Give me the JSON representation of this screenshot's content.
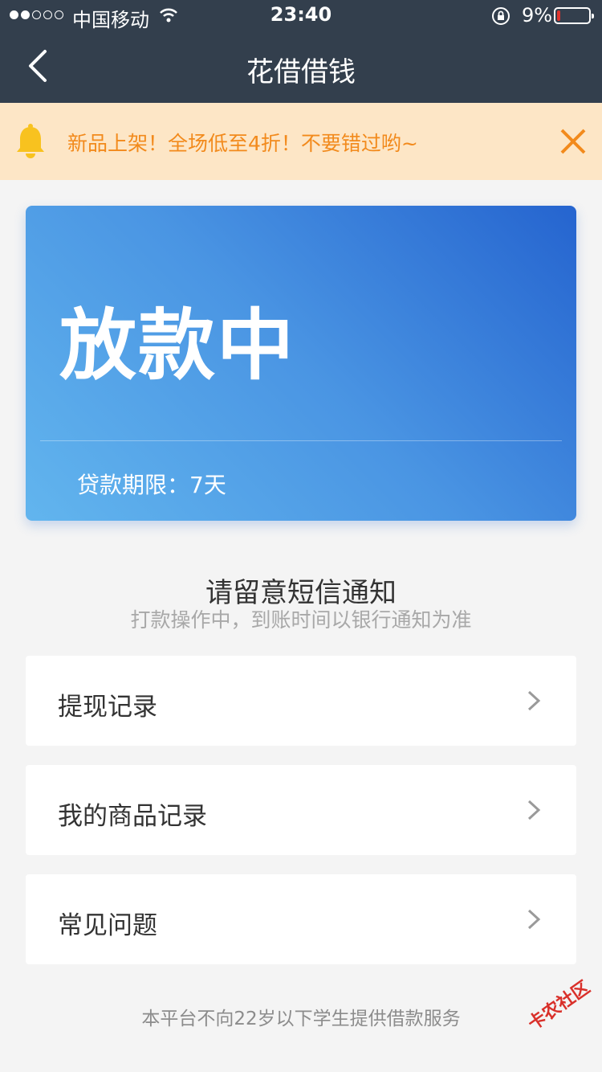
{
  "status_bar": {
    "carrier": "中国移动",
    "time": "23:40",
    "battery": "9%"
  },
  "header": {
    "title": "花借借钱"
  },
  "notice": {
    "text": "新品上架！全场低至4折！不要错过哟~"
  },
  "card": {
    "status": "放款中",
    "term": "贷款期限：7天"
  },
  "notify": {
    "title": "请留意短信通知",
    "subtitle": "打款操作中，到账时间以银行通知为准"
  },
  "menu": [
    {
      "label": "提现记录"
    },
    {
      "label": "我的商品记录"
    },
    {
      "label": "常见问题"
    }
  ],
  "footer": {
    "text": "本平台不向22岁以下学生提供借款服务"
  },
  "watermark": {
    "text": "卡农社区"
  },
  "colors": {
    "header_bg": "#333f4d",
    "notice_bg": "#fde6c6",
    "notice_text": "#f28a1c",
    "card_start": "#62b5ee",
    "card_end": "#2564cf"
  }
}
